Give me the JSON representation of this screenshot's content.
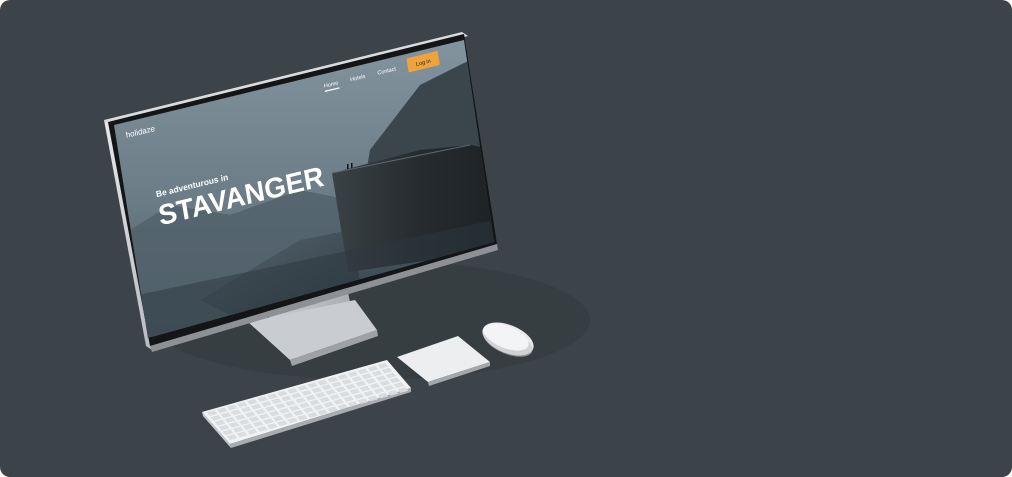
{
  "site": {
    "logo": "holidaze",
    "nav": [
      {
        "label": "Home",
        "active": true
      },
      {
        "label": "Hotels",
        "active": false
      },
      {
        "label": "Contact",
        "active": false
      }
    ],
    "login_label": "Log in"
  },
  "hero": {
    "subtitle": "Be adventurous in",
    "title": "STAVANGER"
  },
  "colors": {
    "background": "#3d4449",
    "accent": "#f0a33a",
    "bezel": "#151719",
    "sky": "#7b8a93",
    "cliff": "#2a3033"
  },
  "devices": [
    "monitor",
    "keyboard",
    "trackpad",
    "mouse"
  ]
}
